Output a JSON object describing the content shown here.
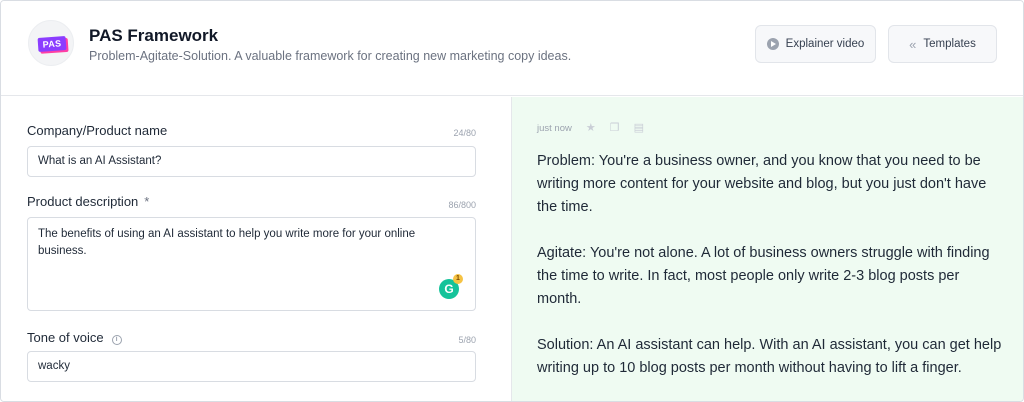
{
  "header": {
    "logo_text": "PAS",
    "title": "PAS Framework",
    "subtitle": "Problem-Agitate-Solution. A valuable framework for creating new marketing copy ideas.",
    "explainer_label": "Explainer video",
    "templates_label": "Templates"
  },
  "form": {
    "company": {
      "label": "Company/Product name",
      "counter": "24/80",
      "value": "What is an AI Assistant?"
    },
    "description": {
      "label": "Product description",
      "required_mark": "*",
      "counter": "86/800",
      "value": "The benefits of using an AI assistant to help you write more for your online business."
    },
    "tone": {
      "label": "Tone of voice",
      "counter": "5/80",
      "value": "wacky"
    },
    "grammarly_count": "1"
  },
  "output": {
    "timestamp": "just now",
    "paragraphs": [
      "Problem: You're a business owner, and you know that you need to be writing more content for your website and blog, but you just don't have the time.",
      "Agitate: You're not alone. A lot of business owners struggle with finding the time to write. In fact, most people only write 2-3 blog posts per month.",
      "Solution: An AI assistant can help. With an AI assistant, you can get help writing up to 10 blog posts per month without having to lift a finger."
    ]
  },
  "icons": {
    "explainer": "play-icon",
    "templates": "chevrons-left-icon",
    "tone_info": "info-icon",
    "favorite": "star-icon",
    "copy": "copy-icon",
    "document": "document-icon"
  },
  "colors": {
    "brand": "#8b3dff",
    "output_bg": "#effbf2",
    "grammarly": "#15c39a"
  }
}
